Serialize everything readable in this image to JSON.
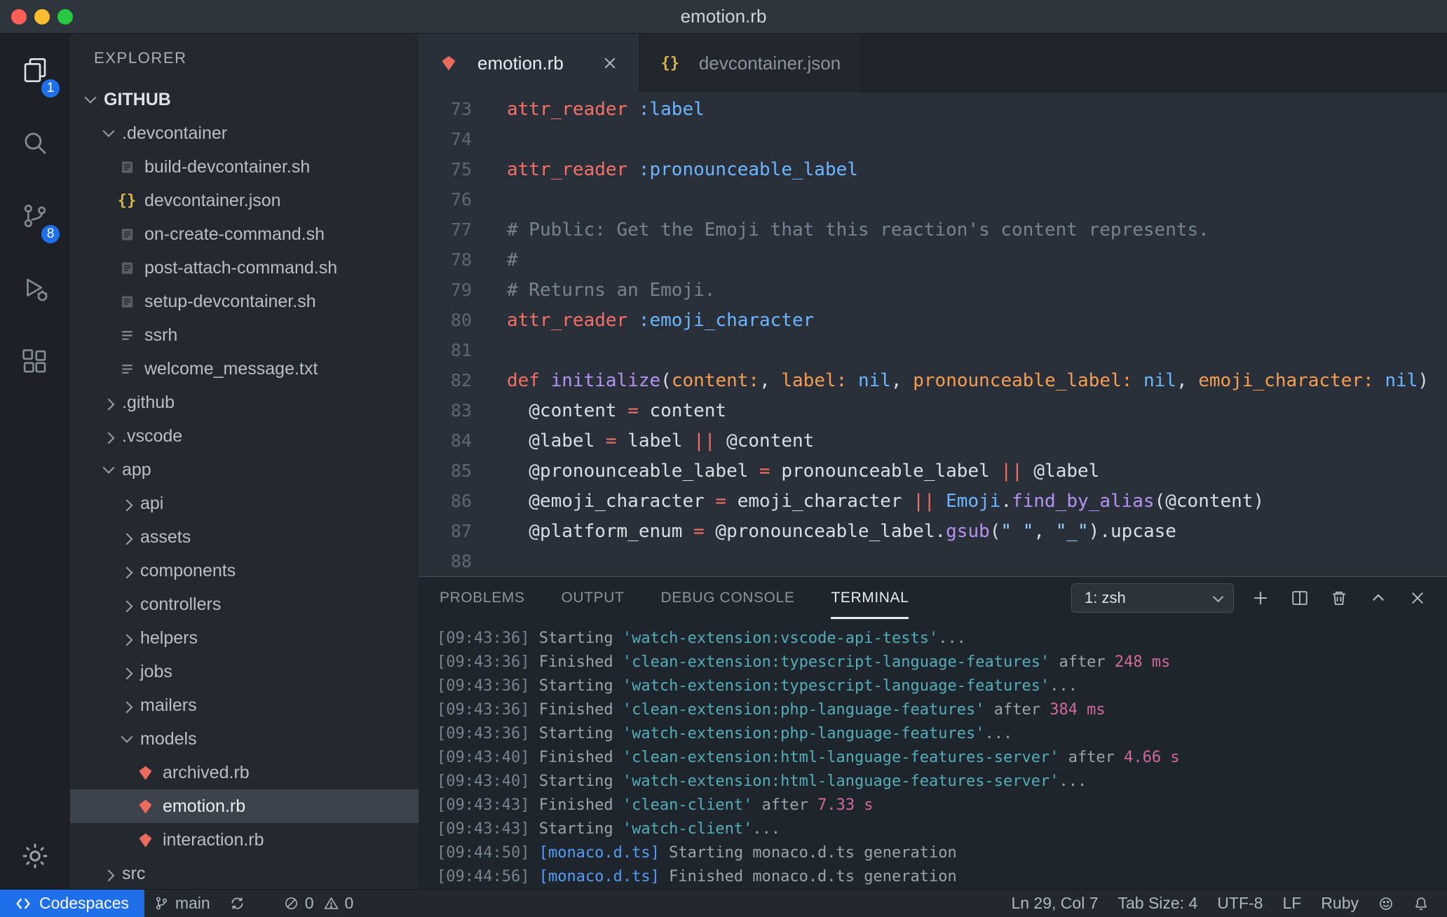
{
  "window": {
    "title": "emotion.rb"
  },
  "colors": {
    "accent_blue": "#1f6feb",
    "codespaces_bg": "#1f6feb",
    "ruby_icon_red": "#ec6a5e",
    "json_icon_yellow": "#d9b44a",
    "keyword_red": "#f47067",
    "symbol_blue": "#6cb6ff",
    "function_purple": "#b392f0",
    "param_orange": "#f69d50",
    "string_blue": "#96d0ff",
    "comment_gray": "#768390",
    "terminal_cyan": "#54aeb8",
    "terminal_pink": "#d2699e",
    "terminal_blue": "#539bf5"
  },
  "activity_bar": {
    "items": [
      {
        "icon": "files-icon",
        "badge": "1",
        "active": true
      },
      {
        "icon": "search-icon"
      },
      {
        "icon": "source-control-icon",
        "badge": "8"
      },
      {
        "icon": "run-debug-icon"
      },
      {
        "icon": "extensions-icon"
      }
    ],
    "bottom_icon": "gear-icon"
  },
  "sidebar": {
    "header": "EXPLORER",
    "tree": [
      {
        "label": "GITHUB",
        "kind": "root",
        "chevron": "down",
        "depth": 0
      },
      {
        "label": ".devcontainer",
        "kind": "folder",
        "chevron": "down",
        "depth": 1
      },
      {
        "label": "build-devcontainer.sh",
        "kind": "file",
        "icon": "sh-file-icon",
        "depth": 2
      },
      {
        "label": "devcontainer.json",
        "kind": "file",
        "icon": "json-icon",
        "depth": 2
      },
      {
        "label": "on-create-command.sh",
        "kind": "file",
        "icon": "sh-file-icon",
        "depth": 2
      },
      {
        "label": "post-attach-command.sh",
        "kind": "file",
        "icon": "sh-file-icon",
        "depth": 2
      },
      {
        "label": "setup-devcontainer.sh",
        "kind": "file",
        "icon": "sh-file-icon",
        "depth": 2
      },
      {
        "label": "ssrh",
        "kind": "file",
        "icon": "list-file-icon",
        "depth": 2
      },
      {
        "label": "welcome_message.txt",
        "kind": "file",
        "icon": "list-file-icon",
        "depth": 2
      },
      {
        "label": ".github",
        "kind": "folder",
        "chevron": "right",
        "depth": 1
      },
      {
        "label": ".vscode",
        "kind": "folder",
        "chevron": "right",
        "depth": 1
      },
      {
        "label": "app",
        "kind": "folder",
        "chevron": "down",
        "depth": 1
      },
      {
        "label": "api",
        "kind": "folder",
        "chevron": "right",
        "depth": 2
      },
      {
        "label": "assets",
        "kind": "folder",
        "chevron": "right",
        "depth": 2
      },
      {
        "label": "components",
        "kind": "folder",
        "chevron": "right",
        "depth": 2
      },
      {
        "label": "controllers",
        "kind": "folder",
        "chevron": "right",
        "depth": 2
      },
      {
        "label": "helpers",
        "kind": "folder",
        "chevron": "right",
        "depth": 2
      },
      {
        "label": "jobs",
        "kind": "folder",
        "chevron": "right",
        "depth": 2
      },
      {
        "label": "mailers",
        "kind": "folder",
        "chevron": "right",
        "depth": 2
      },
      {
        "label": "models",
        "kind": "folder",
        "chevron": "down",
        "depth": 2
      },
      {
        "label": "archived.rb",
        "kind": "file",
        "icon": "ruby-icon",
        "depth": 3
      },
      {
        "label": "emotion.rb",
        "kind": "file",
        "icon": "ruby-icon",
        "depth": 3,
        "selected": true
      },
      {
        "label": "interaction.rb",
        "kind": "file",
        "icon": "ruby-icon",
        "depth": 3
      },
      {
        "label": "src",
        "kind": "folder",
        "chevron": "right",
        "depth": 1
      }
    ]
  },
  "editor": {
    "tabs": [
      {
        "label": "emotion.rb",
        "icon": "ruby-icon",
        "active": true
      },
      {
        "label": "devcontainer.json",
        "icon": "json-icon",
        "active": false
      }
    ],
    "lines": [
      {
        "num": 73,
        "tokens": [
          [
            "k",
            "attr_reader"
          ],
          [
            "d",
            " "
          ],
          [
            "b",
            ":label"
          ]
        ]
      },
      {
        "num": 74,
        "tokens": []
      },
      {
        "num": 75,
        "tokens": [
          [
            "k",
            "attr_reader"
          ],
          [
            "d",
            " "
          ],
          [
            "b",
            ":pronounceable_label"
          ]
        ]
      },
      {
        "num": 76,
        "tokens": []
      },
      {
        "num": 77,
        "tokens": [
          [
            "c",
            "# Public: Get the Emoji that this reaction's content represents."
          ]
        ]
      },
      {
        "num": 78,
        "tokens": [
          [
            "c",
            "#"
          ]
        ]
      },
      {
        "num": 79,
        "tokens": [
          [
            "c",
            "# Returns an Emoji."
          ]
        ]
      },
      {
        "num": 80,
        "tokens": [
          [
            "k",
            "attr_reader"
          ],
          [
            "d",
            " "
          ],
          [
            "b",
            ":emoji_character"
          ]
        ]
      },
      {
        "num": 81,
        "tokens": []
      },
      {
        "num": 82,
        "tokens": [
          [
            "k",
            "def"
          ],
          [
            "d",
            " "
          ],
          [
            "f",
            "initialize"
          ],
          [
            "d",
            "("
          ],
          [
            "o",
            "content:"
          ],
          [
            "d",
            ", "
          ],
          [
            "o",
            "label:"
          ],
          [
            "d",
            " "
          ],
          [
            "b",
            "nil"
          ],
          [
            "d",
            ", "
          ],
          [
            "o",
            "pronounceable_label:"
          ],
          [
            "d",
            " "
          ],
          [
            "b",
            "nil"
          ],
          [
            "d",
            ", "
          ],
          [
            "o",
            "emoji_character:"
          ],
          [
            "d",
            " "
          ],
          [
            "b",
            "nil"
          ],
          [
            "d",
            ")"
          ]
        ]
      },
      {
        "num": 83,
        "tokens": [
          [
            "d",
            "  @content "
          ],
          [
            "k",
            "="
          ],
          [
            "d",
            " content"
          ]
        ]
      },
      {
        "num": 84,
        "tokens": [
          [
            "d",
            "  @label "
          ],
          [
            "k",
            "="
          ],
          [
            "d",
            " label "
          ],
          [
            "k",
            "||"
          ],
          [
            "d",
            " @content"
          ]
        ]
      },
      {
        "num": 85,
        "tokens": [
          [
            "d",
            "  @pronounceable_label "
          ],
          [
            "k",
            "="
          ],
          [
            "d",
            " pronounceable_label "
          ],
          [
            "k",
            "||"
          ],
          [
            "d",
            " @label"
          ]
        ]
      },
      {
        "num": 86,
        "tokens": [
          [
            "d",
            "  @emoji_character "
          ],
          [
            "k",
            "="
          ],
          [
            "d",
            " emoji_character "
          ],
          [
            "k",
            "||"
          ],
          [
            "d",
            " "
          ],
          [
            "b",
            "Emoji"
          ],
          [
            "d",
            "."
          ],
          [
            "f",
            "find_by_alias"
          ],
          [
            "d",
            "(@content)"
          ]
        ]
      },
      {
        "num": 87,
        "tokens": [
          [
            "d",
            "  @platform_enum "
          ],
          [
            "k",
            "="
          ],
          [
            "d",
            " @pronounceable_label."
          ],
          [
            "f",
            "gsub"
          ],
          [
            "d",
            "("
          ],
          [
            "s",
            "\" \""
          ],
          [
            "d",
            ", "
          ],
          [
            "s",
            "\"_\""
          ],
          [
            "d",
            ")."
          ],
          [
            "d",
            "upcase"
          ]
        ]
      },
      {
        "num": 88,
        "tokens": []
      }
    ]
  },
  "panel": {
    "tabs": [
      {
        "label": "PROBLEMS"
      },
      {
        "label": "OUTPUT"
      },
      {
        "label": "DEBUG CONSOLE"
      },
      {
        "label": "TERMINAL",
        "active": true
      }
    ],
    "terminal_select": "1: zsh",
    "control_icons": [
      "new-terminal-icon",
      "split-terminal-icon",
      "trash-icon",
      "maximize-panel-icon",
      "close-panel-icon"
    ],
    "terminal_lines": [
      [
        [
          "t",
          "[09:43:36] "
        ],
        [
          "d",
          "Starting "
        ],
        [
          "c",
          "'watch-extension:vscode-api-tests'"
        ],
        [
          "d",
          "..."
        ]
      ],
      [
        [
          "t",
          "[09:43:36] "
        ],
        [
          "d",
          "Finished "
        ],
        [
          "c",
          "'clean-extension:typescript-language-features'"
        ],
        [
          "d",
          " after "
        ],
        [
          "p",
          "248 ms"
        ]
      ],
      [
        [
          "t",
          "[09:43:36] "
        ],
        [
          "d",
          "Starting "
        ],
        [
          "c",
          "'watch-extension:typescript-language-features'"
        ],
        [
          "d",
          "..."
        ]
      ],
      [
        [
          "t",
          "[09:43:36] "
        ],
        [
          "d",
          "Finished "
        ],
        [
          "c",
          "'clean-extension:php-language-features'"
        ],
        [
          "d",
          " after "
        ],
        [
          "p",
          "384 ms"
        ]
      ],
      [
        [
          "t",
          "[09:43:36] "
        ],
        [
          "d",
          "Starting "
        ],
        [
          "c",
          "'watch-extension:php-language-features'"
        ],
        [
          "d",
          "..."
        ]
      ],
      [
        [
          "t",
          "[09:43:40] "
        ],
        [
          "d",
          "Finished "
        ],
        [
          "c",
          "'clean-extension:html-language-features-server'"
        ],
        [
          "d",
          " after "
        ],
        [
          "p",
          "4.66 s"
        ]
      ],
      [
        [
          "t",
          "[09:43:40] "
        ],
        [
          "d",
          "Starting "
        ],
        [
          "c",
          "'watch-extension:html-language-features-server'"
        ],
        [
          "d",
          "..."
        ]
      ],
      [
        [
          "t",
          "[09:43:43] "
        ],
        [
          "d",
          "Finished "
        ],
        [
          "c",
          "'clean-client'"
        ],
        [
          "d",
          " after "
        ],
        [
          "p",
          "7.33 s"
        ]
      ],
      [
        [
          "t",
          "[09:43:43] "
        ],
        [
          "d",
          "Starting "
        ],
        [
          "c",
          "'watch-client'"
        ],
        [
          "d",
          "..."
        ]
      ],
      [
        [
          "t",
          "[09:44:50] "
        ],
        [
          "b",
          "[monaco.d.ts]"
        ],
        [
          "d",
          " Starting monaco.d.ts generation"
        ]
      ],
      [
        [
          "t",
          "[09:44:56] "
        ],
        [
          "b",
          "[monaco.d.ts]"
        ],
        [
          "d",
          " Finished monaco.d.ts generation"
        ]
      ]
    ]
  },
  "status_bar": {
    "remote_label": "Codespaces",
    "branch": "main",
    "errors": "0",
    "warnings": "0",
    "cursor": "Ln 29, Col 7",
    "indent": "Tab Size: 4",
    "encoding": "UTF-8",
    "eol": "LF",
    "language": "Ruby"
  }
}
